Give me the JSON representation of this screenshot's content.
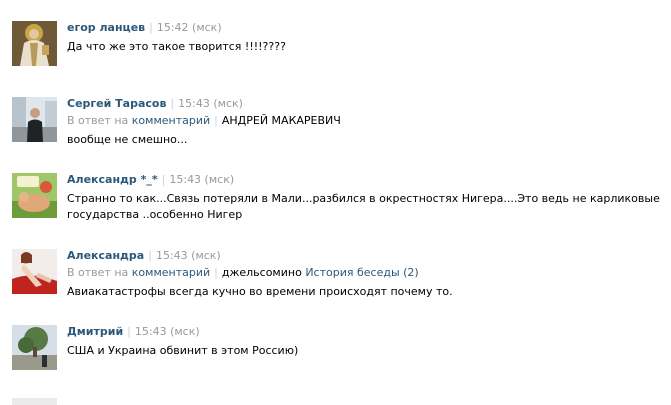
{
  "comments": [
    {
      "author": "егор ланцев",
      "time": "15:42 (мск)",
      "text": "Да что же это такое творится !!!!????",
      "avatar_icon": "saint-icon-avatar"
    },
    {
      "author": "Сергей Тарасов",
      "time": "15:43 (мск)",
      "reply_prefix": "В ответ на",
      "reply_link": "комментарий",
      "reply_to": "АНДРЕЙ МАКАРЕВИЧ",
      "text": "вообще не смешно...",
      "avatar_icon": "man-in-city-avatar"
    },
    {
      "author": "Александр *_*",
      "time": "15:43 (мск)",
      "text": "Странно то как...Связь потеряли в Мали...разбился в окрестностях Нигера....Это ведь не карликовые государства ..особенно Нигер",
      "avatar_icon": "cartoon-avatar"
    },
    {
      "author": "Александра",
      "time": "15:43 (мск)",
      "reply_prefix": "В ответ на",
      "reply_link": "комментарий",
      "reply_to": "джельсомино",
      "reply_history": "История беседы (2)",
      "text": "Авиакатастрофы всегда кучно во времени происходят почему то.",
      "avatar_icon": "woman-red-avatar"
    },
    {
      "author": "Дмитрий",
      "time": "15:43 (мск)",
      "text": "США и Украина обвинит в этом Россию)",
      "avatar_icon": "tree-avatar"
    }
  ],
  "colors": {
    "link": "#2b587a",
    "muted": "#999999",
    "separator": "#c8d2dc"
  }
}
